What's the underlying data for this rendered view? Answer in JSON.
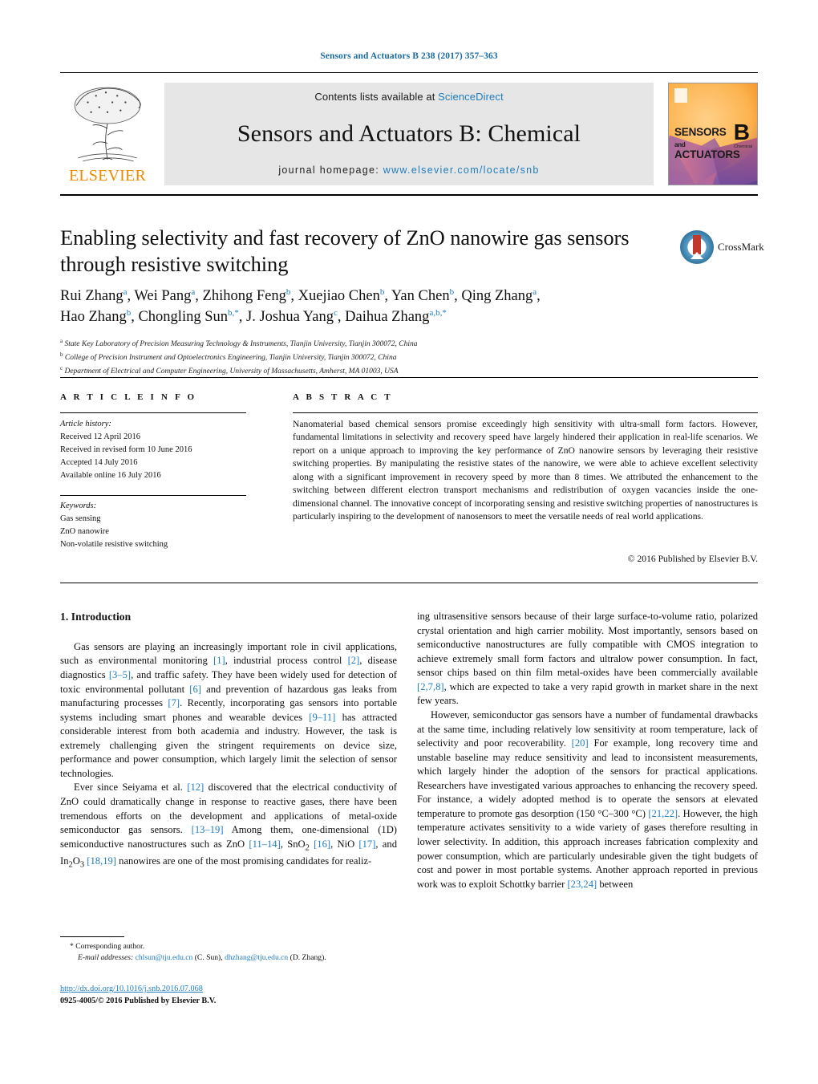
{
  "running_head": "Sensors and Actuators B 238 (2017) 357–363",
  "masthead": {
    "publisher": "ELSEVIER",
    "contents_prefix": "Contents lists available at ",
    "contents_link": "ScienceDirect",
    "journal_title": "Sensors and Actuators B: Chemical",
    "homepage_prefix": "journal homepage: ",
    "homepage_link": "www.elsevier.com/locate/snb",
    "cover": {
      "line1": "SENSORS",
      "and": "and",
      "line2": "ACTUATORS",
      "volume_letter": "B",
      "volume_sub": "Chemical"
    }
  },
  "article": {
    "title": "Enabling selectivity and fast recovery of ZnO nanowire gas sensors through resistive switching",
    "crossmark_label": "CrossMark",
    "authors_line1": "Rui Zhang<sup>a</sup>, Wei Pang<sup>a</sup>, Zhihong Feng<sup>b</sup>, Xuejiao Chen<sup>b</sup>, Yan Chen<sup>b</sup>, Qing Zhang<sup>a</sup>,",
    "authors_line2": "Hao Zhang<sup>b</sup>, Chongling Sun<sup>b,*</sup>, J. Joshua Yang<sup>c</sup>, Daihua Zhang<sup>a,b,*</sup>",
    "affiliations": [
      "<sup>a</sup> State Key Laboratory of Precision Measuring Technology &amp; Instruments, Tianjin University, Tianjin 300072, China",
      "<sup>b</sup> College of Precision Instrument and Optoelectronics Engineering, Tianjin University, Tianjin 300072, China",
      "<sup>c</sup> Department of Electrical and Computer Engineering, University of Massachusetts, Amherst, MA 01003, USA"
    ]
  },
  "article_info": {
    "heading": "A R T I C L E   I N F O",
    "history_label": "Article history:",
    "history": [
      "Received 12 April 2016",
      "Received in revised form 10 June 2016",
      "Accepted 14 July 2016",
      "Available online 16 July 2016"
    ],
    "keywords_label": "Keywords:",
    "keywords": [
      "Gas sensing",
      "ZnO nanowire",
      "Non-volatile resistive switching"
    ]
  },
  "abstract": {
    "heading": "A B S T R A C T",
    "text": "Nanomaterial based chemical sensors promise exceedingly high sensitivity with ultra-small form factors. However, fundamental limitations in selectivity and recovery speed have largely hindered their application in real-life scenarios. We report on a unique approach to improving the key performance of ZnO nanowire sensors by leveraging their resistive switching properties. By manipulating the resistive states of the nanowire, we were able to achieve excellent selectivity along with a significant improvement in recovery speed by more than 8 times. We attributed the enhancement to the switching between different electron transport mechanisms and redistribution of oxygen vacancies inside the one-dimensional channel. The innovative concept of incorporating sensing and resistive switching properties of nanostructures is particularly inspiring to the development of nanosensors to meet the versatile needs of real world applications.",
    "copyright": "© 2016 Published by Elsevier B.V."
  },
  "body": {
    "section_heading": "1.  Introduction",
    "left_paragraphs": [
      "Gas sensors are playing an increasingly important role in civil applications, such as environmental monitoring <span class=\"ref\">[1]</span>, industrial process control <span class=\"ref\">[2]</span>, disease diagnostics <span class=\"ref\">[3–5]</span>, and traffic safety. They have been widely used for detection of toxic environmental pollutant <span class=\"ref\">[6]</span> and prevention of hazardous gas leaks from manufacturing processes <span class=\"ref\">[7]</span>. Recently, incorporating gas sensors into portable systems including smart phones and wearable devices <span class=\"ref\">[9–11]</span> has attracted considerable interest from both academia and industry. However, the task is extremely challenging given the stringent requirements on device size, performance and power consumption, which largely limit the selection of sensor technologies.",
      "Ever since Seiyama et al. <span class=\"ref\">[12]</span> discovered that the electrical conductivity of ZnO could dramatically change in response to reactive gases, there have been tremendous efforts on the development and applications of metal-oxide semiconductor gas sensors. <span class=\"ref\">[13–19]</span> Among them, one-dimensional (1D) semiconductive nanostructures such as ZnO <span class=\"ref\">[11–14]</span>, SnO<sub>2</sub> <span class=\"ref\">[16]</span>, NiO <span class=\"ref\">[17]</span>, and In<sub>2</sub>O<sub>3</sub> <span class=\"ref\">[18,19]</span> nanowires are one of the most promising candidates for realiz-"
    ],
    "right_paragraphs": [
      "ing ultrasensitive sensors because of their large surface-to-volume ratio, polarized crystal orientation and high carrier mobility. Most importantly, sensors based on semiconductive nanostructures are fully compatible with CMOS integration to achieve extremely small form factors and ultralow power consumption. In fact, sensor chips based on thin film metal-oxides have been commercially available <span class=\"ref\">[2,7,8]</span>, which are expected to take a very rapid growth in market share in the next few years.",
      "However, semiconductor gas sensors have a number of fundamental drawbacks at the same time, including relatively low sensitivity at room temperature, lack of selectivity and poor recoverability. <span class=\"ref\">[20]</span> For example, long recovery time and unstable baseline may reduce sensitivity and lead to inconsistent measurements, which largely hinder the adoption of the sensors for practical applications. Researchers have investigated various approaches to enhancing the recovery speed. For instance, a widely adopted method is to operate the sensors at elevated temperature to promote gas desorption (150 °C–300 °C) <span class=\"ref\">[21,22]</span>. However, the high temperature activates sensitivity to a wide variety of gases therefore resulting in lower selectivity. In addition, this approach increases fabrication complexity and power consumption, which are particularly undesirable given the tight budgets of cost and power in most portable systems. Another approach reported in previous work was to exploit Schottky barrier <span class=\"ref\">[23,24]</span> between"
    ]
  },
  "footer": {
    "corresponding_marker": "*",
    "corresponding_label": "Corresponding author.",
    "email_label": "E-mail addresses:",
    "email_1": "chlsun@tju.edu.cn",
    "email_1_owner": "(C. Sun),",
    "email_2": "dhzhang@tju.edu.cn",
    "email_2_owner": "(D. Zhang).",
    "doi": "http://dx.doi.org/10.1016/j.snb.2016.07.068",
    "issn_line": "0925-4005/© 2016 Published by Elsevier B.V."
  },
  "colors": {
    "link": "#1e7cc0",
    "runhead": "#1a6ba0",
    "elsevier_orange": "#ED8B00",
    "banner_bg": "#e6e6e6"
  }
}
